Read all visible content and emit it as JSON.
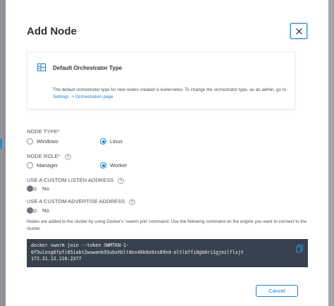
{
  "modal": {
    "title": "Add Node"
  },
  "info": {
    "title": "Default Orchestrator Type",
    "text_prefix": "The default orchestrator type for new nodes created is kubernetes. To change the orchestrator type, as an admin, go to ",
    "link_text": "Settings -> Orchestration page"
  },
  "node_type": {
    "label": "NODE TYPE*",
    "options": [
      "Windows",
      "Linux"
    ],
    "selected": "Linux"
  },
  "node_role": {
    "label": "NODE ROLE*",
    "options": [
      "Manager",
      "Worker"
    ],
    "selected": "Worker"
  },
  "listen_address": {
    "label": "USE A CUSTOM LISTEN ADDRESS",
    "toggle_label": "No"
  },
  "advertise_address": {
    "label": "USE A CUSTOM ADVERTISE ADDRESS",
    "toggle_label": "No"
  },
  "description": "Nodes are added to the cluster by using Docker's 'swarm join' command. Use the following command on the engine you want to connect to the cluster.",
  "command": {
    "line1": "docker swarm join --token SWMTKN-1-",
    "line2": "0f5ulesg6fpfi05iabt2wuwank93ubxhblt8ox46k0a9zs89nd-oltlbffi0gb0ri1gjeilflsjt",
    "line3": "172.31.12.116:2377"
  },
  "footer": {
    "cancel_label": "Cancel"
  },
  "colors": {
    "accent": "#1f7fc8",
    "code_bg": "#38424e",
    "overlay": "#9a9da1"
  },
  "icons": {
    "close": "close-icon",
    "info": "layout-grid-icon",
    "help": "question-circle-icon",
    "copy": "copy-icon"
  }
}
